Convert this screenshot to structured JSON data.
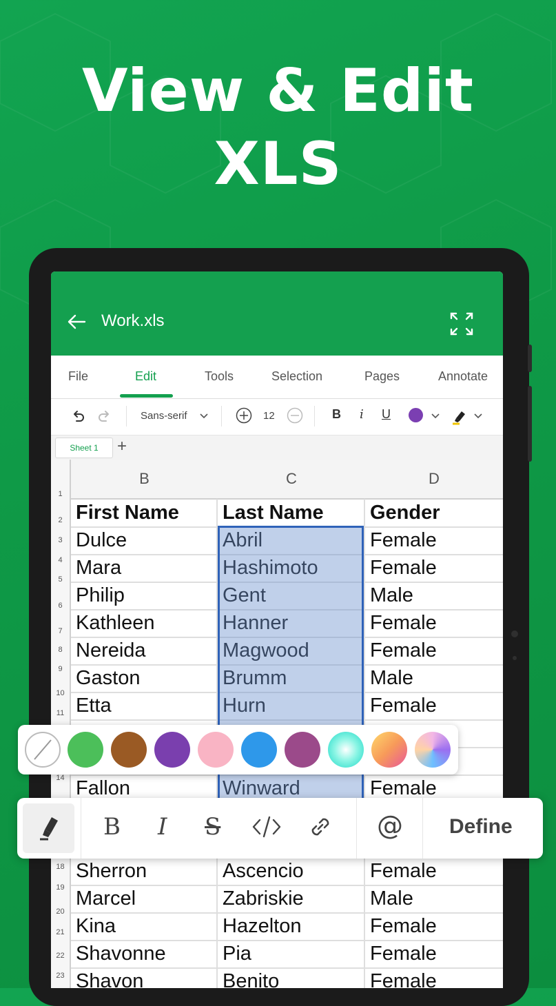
{
  "headline": {
    "line1": "View & Edit",
    "line2": "XLS"
  },
  "app": {
    "title": "Work.xls",
    "menu": [
      "File",
      "Edit",
      "Tools",
      "Selection",
      "Pages",
      "Annotate"
    ],
    "active_menu": "Edit",
    "toolbar": {
      "font": "Sans-serif",
      "size": "12",
      "bold": "B",
      "italic": "i",
      "underline": "U",
      "text_color": "#7b3fb2"
    },
    "sheet_tab": "Sheet 1",
    "columns": [
      "B",
      "C",
      "D"
    ],
    "row_numbers": [
      "1",
      "2",
      "3",
      "4",
      "5",
      "6",
      "7",
      "8",
      "9",
      "10",
      "11",
      "14",
      "18",
      "19",
      "20",
      "21",
      "22",
      "23"
    ],
    "header": [
      "First Name",
      "Last Name",
      "Gender"
    ],
    "rows_top": [
      [
        "Dulce",
        "Abril",
        "Female"
      ],
      [
        "Mara",
        "Hashimoto",
        "Female"
      ],
      [
        "Philip",
        "Gent",
        "Male"
      ],
      [
        "Kathleen",
        "Hanner",
        "Female"
      ],
      [
        "Nereida",
        "Magwood",
        "Female"
      ],
      [
        "Gaston",
        "Brumm",
        "Male"
      ],
      [
        "Etta",
        "Hurn",
        "Female"
      ]
    ],
    "row_partial": [
      "Fallon",
      "Winward",
      "Female"
    ],
    "rows_bottom": [
      [
        "Sherron",
        "Ascencio",
        "Female"
      ],
      [
        "Marcel",
        "Zabriskie",
        "Male"
      ],
      [
        "Kina",
        "Hazelton",
        "Female"
      ],
      [
        "Shavonne",
        "Pia",
        "Female"
      ],
      [
        "Shavon",
        "Benito",
        "Female"
      ]
    ]
  },
  "palette": [
    "none",
    "#4cbf5a",
    "#9a5a24",
    "#7a3fae",
    "#f9b4c4",
    "#2e98ea",
    "#9b4a8a",
    "aqua-gradient",
    "orange-gradient",
    "rainbow-gradient"
  ],
  "format_bar": {
    "bold": "B",
    "italic": "I",
    "strike": "S",
    "at": "@",
    "define": "Define"
  }
}
